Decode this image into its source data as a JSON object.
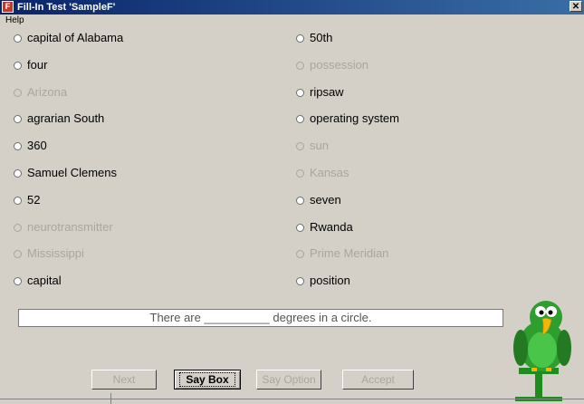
{
  "window": {
    "title": "Fill-In Test  'SampleF'",
    "close_glyph": "✕",
    "app_icon": "app-icon"
  },
  "menu": {
    "items": [
      "Help"
    ]
  },
  "options_left": [
    {
      "label": "capital of Alabama",
      "enabled": true
    },
    {
      "label": "four",
      "enabled": true
    },
    {
      "label": "Arizona",
      "enabled": false
    },
    {
      "label": "agrarian South",
      "enabled": true
    },
    {
      "label": "360",
      "enabled": true
    },
    {
      "label": "Samuel Clemens",
      "enabled": true
    },
    {
      "label": "52",
      "enabled": true
    },
    {
      "label": "neurotransmitter",
      "enabled": false
    },
    {
      "label": "Mississippi",
      "enabled": false
    },
    {
      "label": "capital",
      "enabled": true
    }
  ],
  "options_right": [
    {
      "label": "50th",
      "enabled": true
    },
    {
      "label": "possession",
      "enabled": false
    },
    {
      "label": "ripsaw",
      "enabled": true
    },
    {
      "label": "operating system",
      "enabled": true
    },
    {
      "label": "sun",
      "enabled": false
    },
    {
      "label": "Kansas",
      "enabled": false
    },
    {
      "label": "seven",
      "enabled": true
    },
    {
      "label": "Rwanda",
      "enabled": true
    },
    {
      "label": "Prime Meridian",
      "enabled": false
    },
    {
      "label": "position",
      "enabled": true
    }
  ],
  "prompt": {
    "text": "There are __________ degrees in a circle."
  },
  "buttons": {
    "next": {
      "label": "Next",
      "enabled": false
    },
    "say_box": {
      "label": "Say Box",
      "enabled": true
    },
    "say_option": {
      "label": "Say Option",
      "enabled": false
    },
    "accept": {
      "label": "Accept",
      "enabled": false
    }
  },
  "mascot": {
    "icon": "parrot-mascot",
    "colors": {
      "body": "#2e9e2e",
      "beak": "#f2b705",
      "perch": "#1e8c1e"
    }
  }
}
